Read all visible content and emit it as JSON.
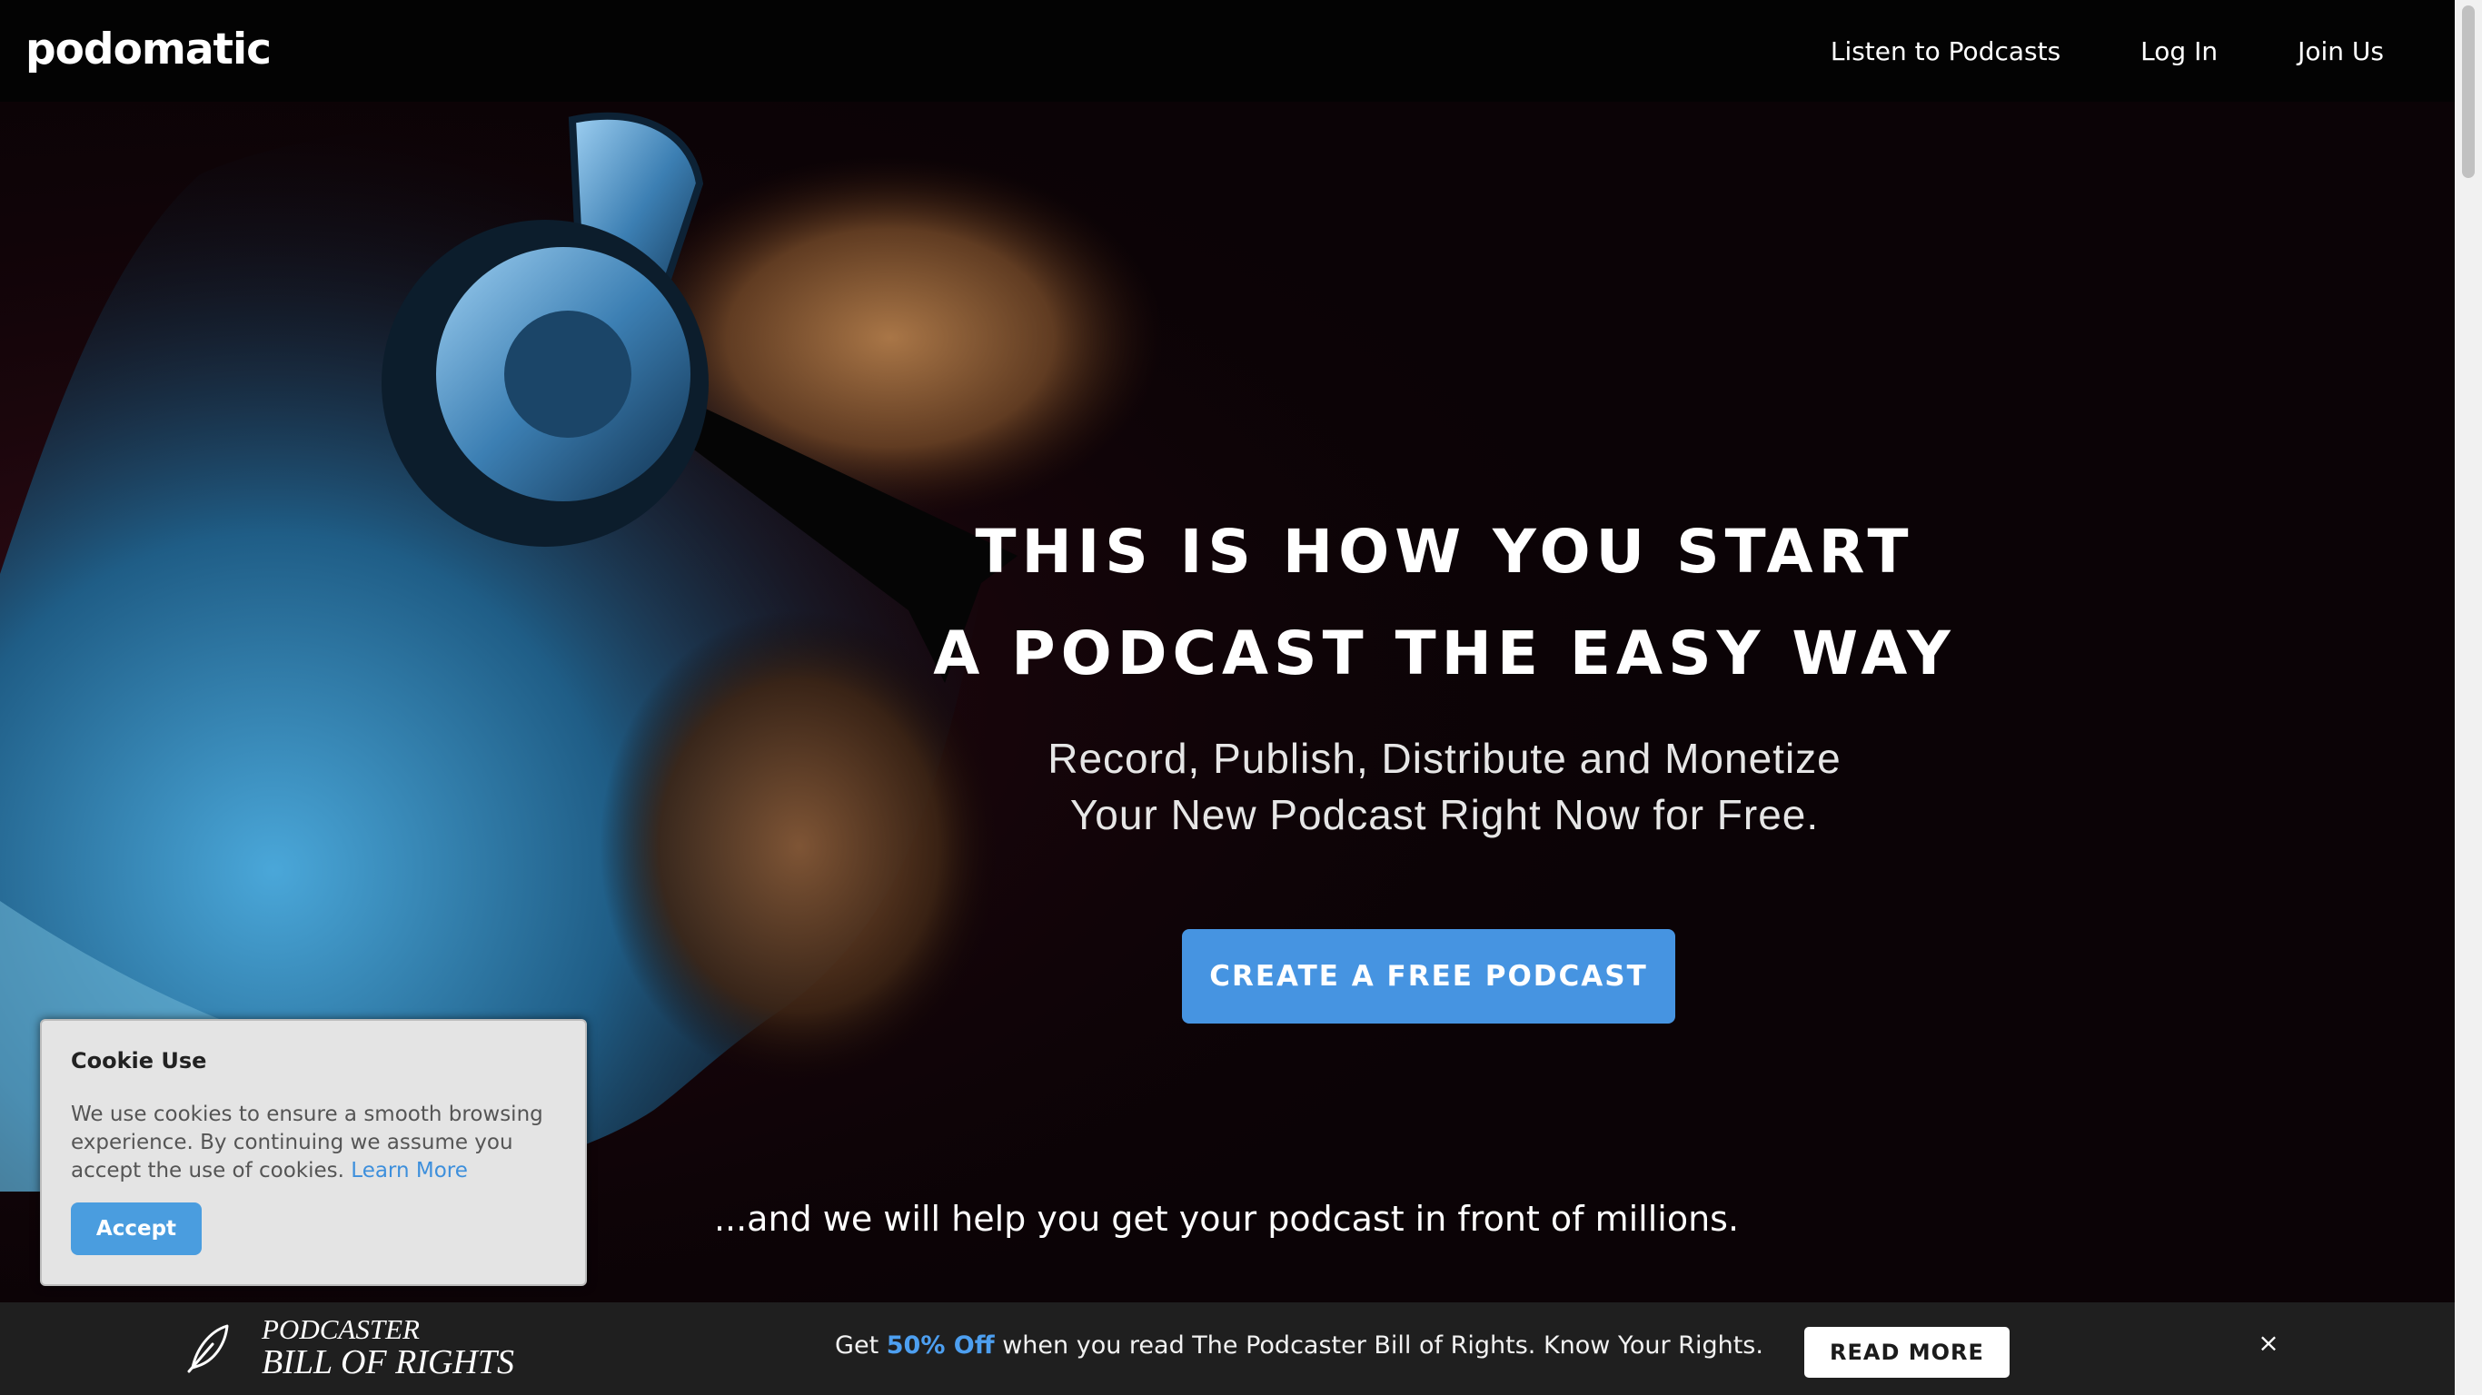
{
  "header": {
    "logo_text": "podomatic",
    "nav": {
      "listen": "Listen to Podcasts",
      "login": "Log In",
      "join": "Join Us"
    }
  },
  "hero": {
    "title_line1": "THIS IS HOW YOU START",
    "title_line2": "A PODCAST THE EASY WAY",
    "subtitle_line1": "Record, Publish, Distribute and Monetize",
    "subtitle_line2": "Your New Podcast Right Now for Free.",
    "cta_label": "CREATE A FREE PODCAST",
    "tagline": "...and we will help you get your podcast in front of millions."
  },
  "cookie": {
    "title": "Cookie Use",
    "text": "We use cookies to ensure a smooth browsing experience. By continuing we assume you accept the use of cookies.",
    "link_label": "Learn More",
    "accept_label": "Accept"
  },
  "promo": {
    "brand_line1": "PODCASTER",
    "brand_line2": "BILL OF RIGHTS",
    "msg_prefix": "Get",
    "msg_highlight": "50% Off",
    "msg_suffix": "when you read The Podcaster Bill of Rights. Know Your Rights.",
    "read_more_label": "READ MORE",
    "close_symbol": "×"
  },
  "colors": {
    "accent": "#4694e1",
    "link": "#3d8fdc",
    "promo_highlight": "#4d9ff0",
    "navbar_bg": "#030303",
    "promo_bg": "#1f1f1f"
  },
  "icons": {
    "feather": "feather-icon",
    "close": "close-icon"
  }
}
